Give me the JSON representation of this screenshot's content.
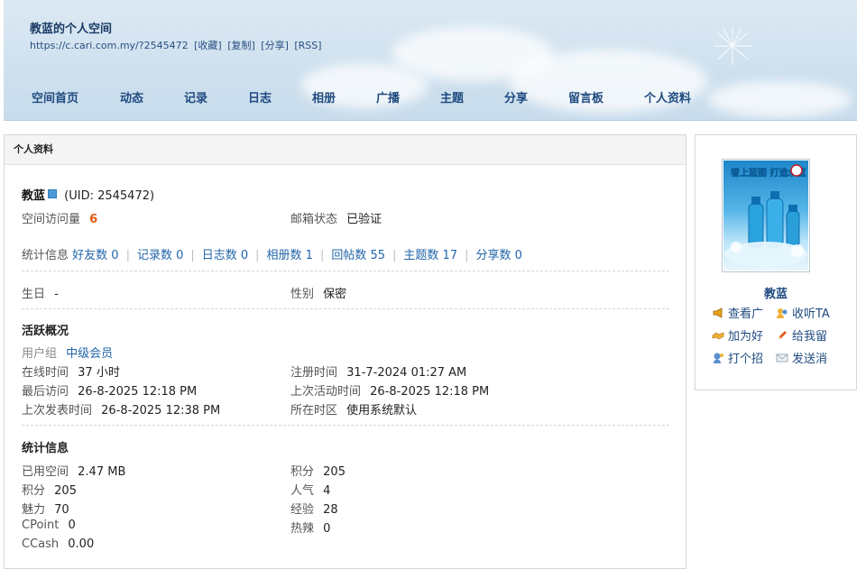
{
  "header": {
    "title": "教蓝的个人空间",
    "url": "https://c.cari.com.my/?2545472",
    "links": [
      "[收藏]",
      "[复制]",
      "[分享]",
      "[RSS]"
    ],
    "nav": [
      "空间首页",
      "动态",
      "记录",
      "日志",
      "相册",
      "广播",
      "主题",
      "分享",
      "留言板",
      "个人资料"
    ]
  },
  "panel": {
    "title": "个人资料",
    "username": "教蓝",
    "uid": "(UID: 2545472)",
    "visits_label": "空间访问量",
    "visits_value": "6",
    "email_label": "邮箱状态",
    "email_value": "已验证",
    "stats_label": "统计信息",
    "stats": [
      "好友数 0",
      "记录数 0",
      "日志数 0",
      "相册数 1",
      "回帖数 55",
      "主题数 17",
      "分享数 0"
    ],
    "birthday_label": "生日",
    "birthday_value": "-",
    "gender_label": "性别",
    "gender_value": "保密",
    "activity_title": "活跃概况",
    "group_label": "用户组",
    "group_value": "中级会员",
    "online_label": "在线时间",
    "online_value": "37 小时",
    "register_label": "注册时间",
    "register_value": "31-7-2024 01:27 AM",
    "last_visit_label": "最后访问",
    "last_visit_value": "26-8-2025 12:18 PM",
    "last_active_label": "上次活动时间",
    "last_active_value": "26-8-2025 12:18 PM",
    "last_post_label": "上次发表时间",
    "last_post_value": "26-8-2025 12:38 PM",
    "timezone_label": "所在时区",
    "timezone_value": "使用系统默认",
    "stats_title": "统计信息",
    "space_label": "已用空间",
    "space_value": "2.47 MB",
    "points_label": "积分",
    "points_value": "205",
    "points2_label": "积分",
    "points2_value": "205",
    "popularity_label": "人气",
    "popularity_value": "4",
    "charm_label": "魅力",
    "charm_value": "70",
    "exp_label": "经验",
    "exp_value": "28",
    "cpoint_label": "CPoint",
    "cpoint_value": "0",
    "hot_label": "热辣",
    "hot_value": "0",
    "ccash_label": "CCash",
    "ccash_value": "0.00"
  },
  "sidebar": {
    "name": "教蓝",
    "avatar_text": "看上蓝图 打造水蓝",
    "actions": {
      "view_ad": "查看广",
      "follow": "收听TA",
      "add_friend": "加为好",
      "leave_msg": "给我留",
      "greet": "打个招",
      "send_msg": "发送消"
    }
  },
  "colors": {
    "accent": "#1f4a80",
    "link": "#2a6aa8",
    "highlight": "#e05a12"
  }
}
